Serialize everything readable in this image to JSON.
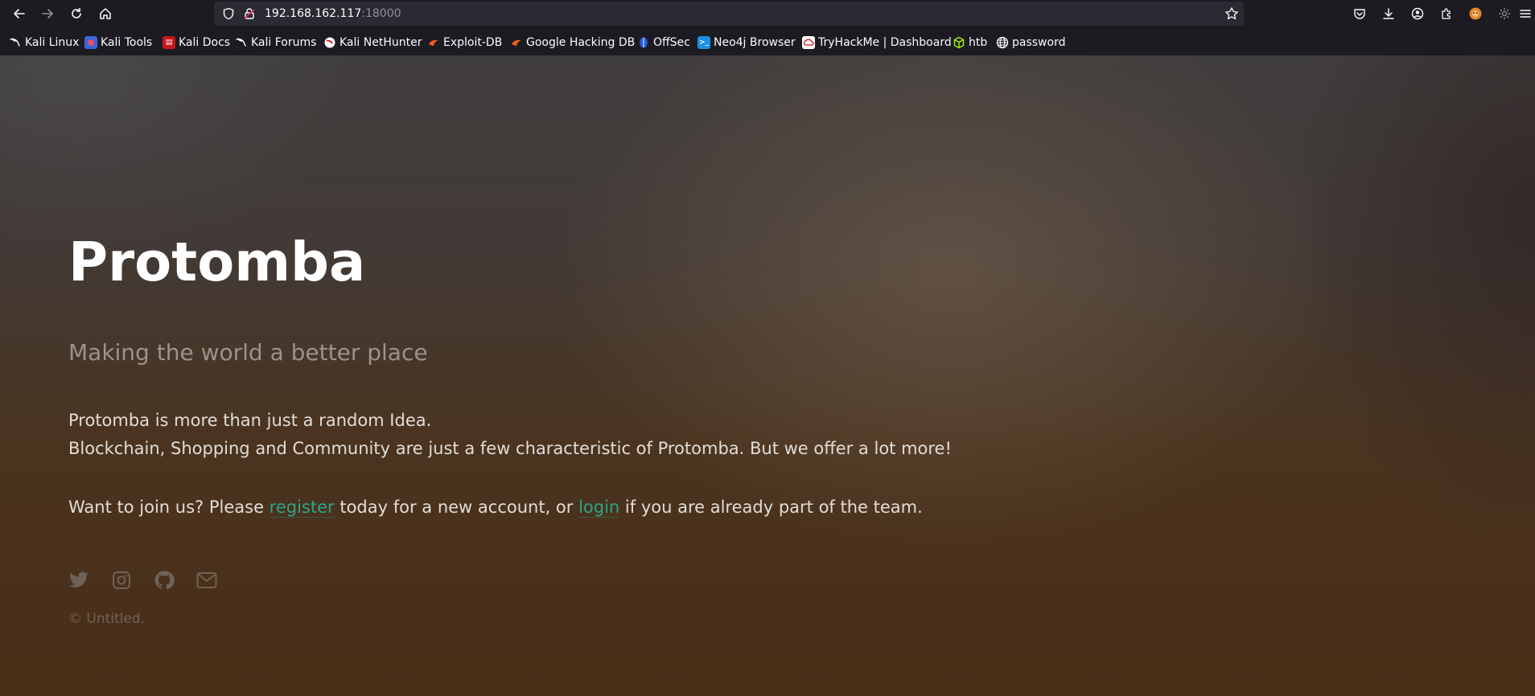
{
  "browser": {
    "url_host": "192.168.162.117",
    "url_port": ":18000",
    "nav_icons": [
      "back-arrow-icon",
      "forward-arrow-icon",
      "reload-icon",
      "home-icon"
    ],
    "right_icons": [
      "pocket-icon",
      "download-icon",
      "account-icon",
      "extensions-icon",
      "foxyproxy-icon",
      "settings-icon",
      "menu-icon"
    ]
  },
  "bookmarks": [
    {
      "label": "Kali Linux",
      "icon": "kali-dragon-icon"
    },
    {
      "label": "Kali Tools",
      "icon": "kali-tools-icon"
    },
    {
      "label": "Kali Docs",
      "icon": "kali-docs-icon"
    },
    {
      "label": "Kali Forums",
      "icon": "kali-dragon-icon"
    },
    {
      "label": "Kali NetHunter",
      "icon": "nethunter-icon"
    },
    {
      "label": "Exploit-DB",
      "icon": "exploitdb-icon"
    },
    {
      "label": "Google Hacking DB",
      "icon": "exploitdb-icon"
    },
    {
      "label": "OffSec",
      "icon": "offsec-icon"
    },
    {
      "label": "Neo4j Browser",
      "icon": "terminal-icon"
    },
    {
      "label": "TryHackMe | Dashboard",
      "icon": "tryhackme-icon"
    },
    {
      "label": "htb",
      "icon": "htb-cube-icon"
    },
    {
      "label": "password",
      "icon": "globe-icon"
    }
  ],
  "hero": {
    "title": "Protomba",
    "tagline": "Making the world a better place",
    "desc_line1": "Protomba is more than just a random Idea.",
    "desc_line2": "Blockchain, Shopping and Community are just a few characteristic of Protomba. But we offer a lot more!",
    "join_prefix": "Want to join us? Please ",
    "register_link": "register",
    "join_middle": " today for a new account, or ",
    "login_link": "login",
    "join_suffix": " if you are already part of the team.",
    "copyright": "© Untitled."
  },
  "social_icons": [
    "twitter-icon",
    "instagram-icon",
    "github-icon",
    "mail-icon"
  ],
  "colors": {
    "link": "#2aa588",
    "title": "#ffffff",
    "body_text": "#e2dcd6",
    "tagline": "#9a928a"
  }
}
